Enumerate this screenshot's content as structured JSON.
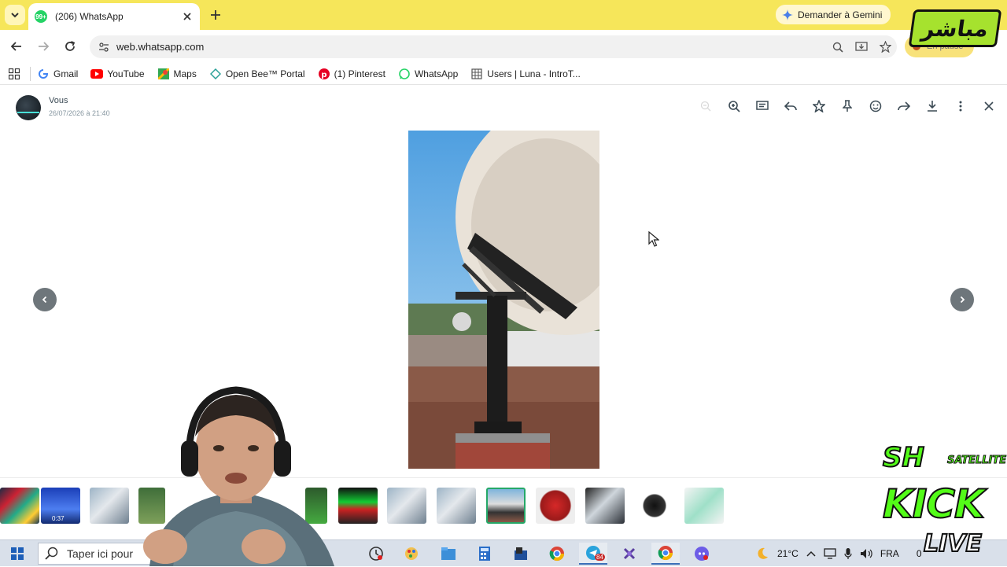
{
  "browser": {
    "tab": {
      "badge": "99+",
      "title": "(206) WhatsApp"
    },
    "gemini_label": "Demander à Gemini",
    "url": "web.whatsapp.com",
    "profile_label": "En pause",
    "bookmarks": [
      {
        "label": "Gmail",
        "icon": "gmail-icon"
      },
      {
        "label": "YouTube",
        "icon": "youtube-icon"
      },
      {
        "label": "Maps",
        "icon": "maps-icon"
      },
      {
        "label": "Open Bee™ Portal",
        "icon": "openbee-icon"
      },
      {
        "label": "(1) Pinterest",
        "icon": "pinterest-icon"
      },
      {
        "label": "WhatsApp",
        "icon": "whatsapp-icon"
      },
      {
        "label": "Users | Luna - IntroT...",
        "icon": "table-icon"
      }
    ]
  },
  "viewer": {
    "sender_name": "Vous",
    "timestamp": "26/07/2026 à 21:40",
    "actions": [
      "zoom-out-icon",
      "zoom-in-icon",
      "chat-icon",
      "reply-icon",
      "star-icon",
      "pin-icon",
      "emoji-icon",
      "forward-icon",
      "download-icon",
      "more-icon",
      "close-icon"
    ],
    "thumbnails": [
      {
        "kind": "screen-colors"
      },
      {
        "kind": "person-blue",
        "duration": "0:37"
      },
      {
        "kind": "dish-sky"
      },
      {
        "kind": "partial-green"
      },
      {
        "kind": "screen-green"
      },
      {
        "kind": "screen-spectrum"
      },
      {
        "kind": "dish-sky"
      },
      {
        "kind": "dish-sky"
      },
      {
        "kind": "dish-mount",
        "selected": true
      },
      {
        "kind": "red-meter"
      },
      {
        "kind": "dish-dark"
      },
      {
        "kind": "gauge"
      },
      {
        "kind": "diagram"
      }
    ]
  },
  "taskbar": {
    "search_placeholder": "Taper ici pour",
    "weather": "21°C",
    "language": "FRA",
    "notification_badge": "84",
    "clock_partial": "0"
  },
  "overlays": {
    "corner_logo": "مباشر",
    "stream_brand_top": "SH",
    "stream_brand_sub": "SATELLITE",
    "stream_brand_kick": "KICK",
    "stream_brand_live": "LIVE"
  },
  "colors": {
    "whatsapp_green": "#25d366",
    "tab_strip": "#f6e65a",
    "kick_green": "#53fc18"
  }
}
